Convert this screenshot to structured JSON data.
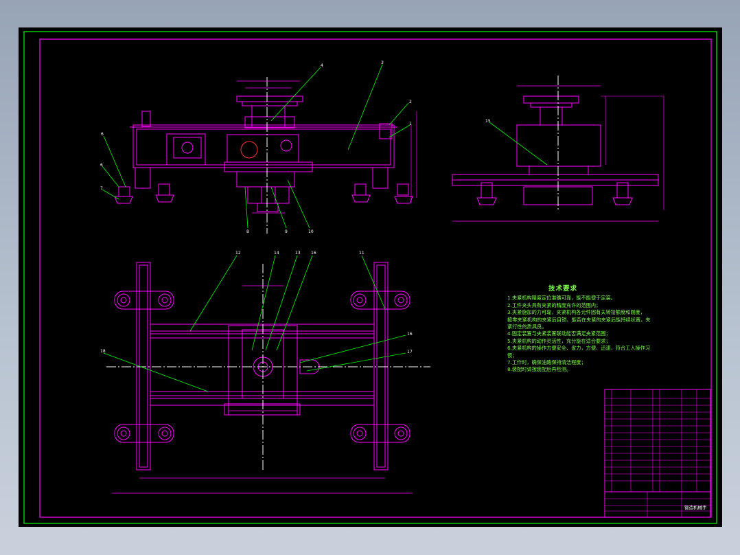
{
  "drawing": {
    "background_color": "#000000",
    "line_colors": {
      "outline": "#ff00ff",
      "border": "#00ff00",
      "center_lines": "#ffffff",
      "hatch": "#ff3030"
    }
  },
  "tech_requirements": {
    "title": "技术要求",
    "items": [
      "1.夹紧机构精度定位准确可靠，能不能便于定装。",
      "2.工件夹头具有夹紧的精度充许的范围内；",
      "3.夹紧施加的力可靠，夹紧机构各元件固有夫转铅额度和刚度，",
      "   按零夹紧机构的夹紧后自锁、能否在夹紧的夹紧后能持续状置，夹",
      "   紧行性的质具良。",
      "4.固定装置与夹紧装置联动能否满足夹紧范围；",
      "5.夹紧机构的动作灵活性，充分能在适合要求；",
      "6.夹紧机构的操作方便安全、省力，方便、迅速，符合工人操作习",
      "   惯；",
      "7.工作时，确保油路保持清洁程度；",
      "8.装配时请按装配后再检测。"
    ]
  },
  "leaders": {
    "front_view": [
      "1",
      "2",
      "3",
      "4",
      "6",
      "6",
      "7",
      "8",
      "9",
      "10"
    ],
    "side_view": [
      "15"
    ],
    "top_view": [
      "12",
      "14",
      "13",
      "16",
      "11",
      "18",
      "16",
      "17"
    ]
  },
  "title_block": {
    "drawing_name": "锻造机械手",
    "rows": 19
  }
}
